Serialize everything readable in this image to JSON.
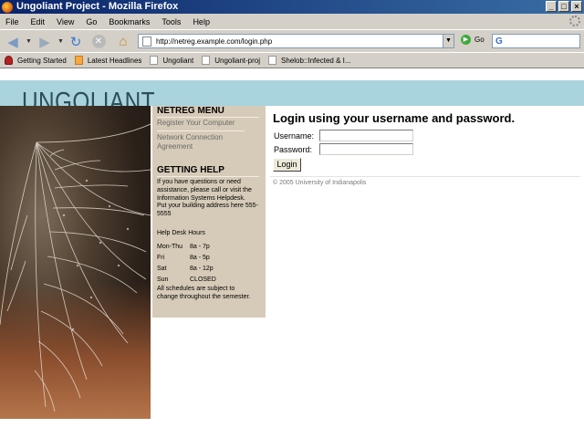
{
  "window": {
    "title": "Ungoliant Project - Mozilla Firefox",
    "controls": [
      "_",
      "□",
      "×"
    ]
  },
  "menu": [
    "File",
    "Edit",
    "View",
    "Go",
    "Bookmarks",
    "Tools",
    "Help"
  ],
  "navbar": {
    "url": "http://netreg.example.com/login.php",
    "go_label": "Go",
    "icons": [
      "back-icon",
      "forward-icon",
      "reload-icon",
      "stop-icon",
      "home-icon",
      "google-search-icon"
    ]
  },
  "bookmarks": [
    "Getting Started",
    "Latest Headlines",
    "Ungoliant",
    "Ungoliant-proj",
    "Shelob::Infected & I..."
  ],
  "page": {
    "banner_title": "UNGOLIANT",
    "sidebar": {
      "menu_heading": "NETREG MENU",
      "links": [
        "Register Your Computer",
        "Network Connection Agreement"
      ],
      "help_heading": "GETTING HELP",
      "help_text": "If you have questions or need assistance, please call or visit the Information Systems Helpdesk.",
      "address_text": "Put your building address here 555-5555",
      "hours_title": "Help Desk Hours",
      "hours": [
        {
          "day": "Mon-Thu",
          "time": "8a - 7p"
        },
        {
          "day": "Fri",
          "time": "8a - 5p"
        },
        {
          "day": "Sat",
          "time": "8a - 12p"
        },
        {
          "day": "Sun",
          "time": "CLOSED"
        }
      ],
      "schedule_note": "All schedules are subject to change throughout the semester."
    },
    "login": {
      "title": "Login using your username and password.",
      "username_label": "Username:",
      "password_label": "Password:",
      "username_value": "",
      "password_value": "",
      "button_label": "Login"
    },
    "copyright": "© 2005 University of Indianapolis"
  }
}
